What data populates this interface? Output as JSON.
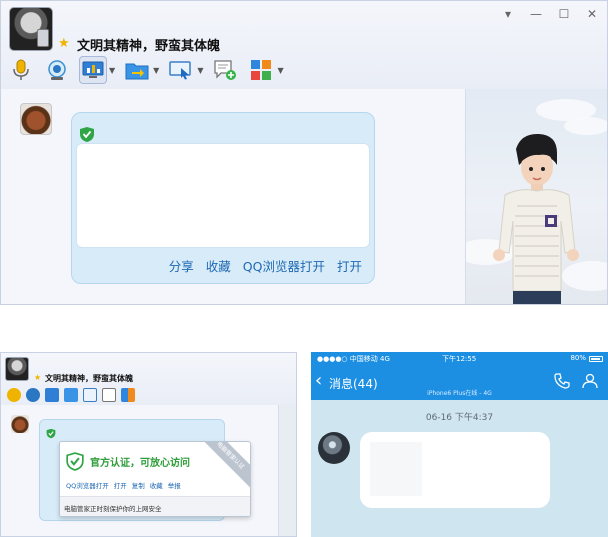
{
  "top_window": {
    "title": "文明其精神，野蛮其体魄",
    "window_controls": {
      "dropdown": "▾",
      "minimize": "—",
      "maximize": "☐",
      "close": "✕"
    },
    "card_actions": [
      "分享",
      "收藏",
      "QQ浏览器打开",
      "打开"
    ]
  },
  "bottom_left_window": {
    "title": "文明其精神，野蛮其体魄",
    "popup": {
      "title": "官方认证，可放心访问",
      "actions": [
        "QQ浏览器打开",
        "打开",
        "复制",
        "收藏",
        "举报"
      ],
      "footer": "电脑管家正时刻保护你的上网安全",
      "ribbon": "电脑管家认证"
    }
  },
  "phone": {
    "status": {
      "carrier": "●●●●○ 中国移动  4G",
      "time": "下午12:55",
      "battery": "80%"
    },
    "nav": {
      "back_label": "消息(44)",
      "subtitle": "iPhone6 Plus在线 - 4G"
    },
    "date_label": "06-16 下午4:37"
  },
  "colors": {
    "accent_blue": "#1d8fe3",
    "link_blue": "#1f69b3",
    "verified_green": "#2e9d3a",
    "card_bg": "#d7ecf8"
  }
}
